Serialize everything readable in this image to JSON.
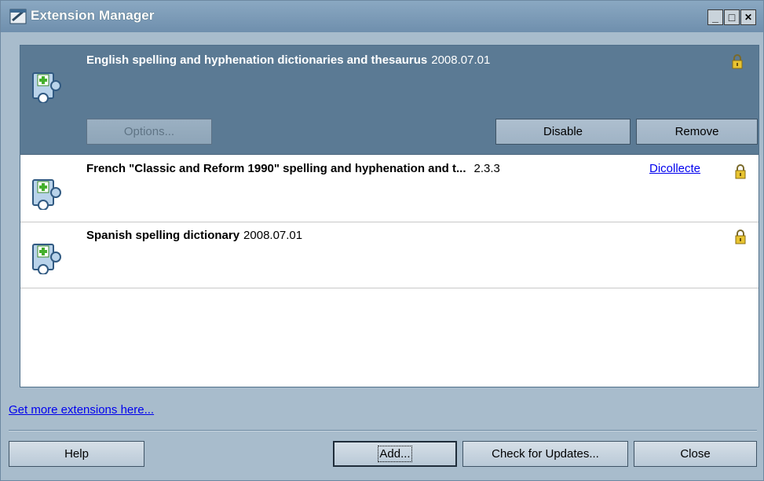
{
  "window": {
    "title": "Extension Manager",
    "controls": {
      "minimize": "_",
      "maximize": "□",
      "close": "✕"
    }
  },
  "extensions": [
    {
      "name": "English spelling and hyphenation dictionaries and thesaurus",
      "version": "2008.07.01",
      "link": "",
      "selected": true,
      "actions": {
        "options": "Options...",
        "disable": "Disable",
        "remove": "Remove"
      }
    },
    {
      "name": "French \"Classic and Reform 1990\" spelling and hyphenation and t...",
      "version": "2.3.3",
      "link": "Dicollecte",
      "selected": false
    },
    {
      "name": "Spanish spelling dictionary",
      "version": "2008.07.01",
      "link": "",
      "selected": false
    }
  ],
  "footer": {
    "get_more": "Get more extensions here...",
    "help": "Help",
    "add": "Add...",
    "check_updates": "Check for Updates...",
    "close": "Close"
  },
  "colors": {
    "selection": "#5b7a94",
    "titlebar": "#7d9bb7",
    "link": "#0000ee"
  }
}
